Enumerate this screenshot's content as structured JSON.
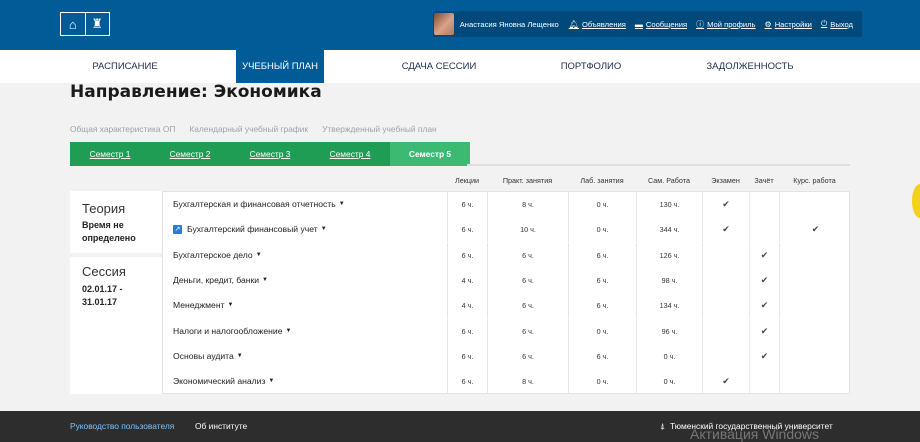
{
  "header": {
    "logo_icons": [
      "university-building-icon",
      "campus-tower-icon"
    ],
    "user_name": "Анастасия Яновна Лещенко",
    "links": [
      {
        "label": "Объявления",
        "icon": "bell-icon"
      },
      {
        "label": "Сообщения",
        "icon": "message-icon"
      },
      {
        "label": "Мой профиль",
        "icon": "info-icon"
      },
      {
        "label": "Настройки",
        "icon": "gear-icon"
      },
      {
        "label": "Выход",
        "icon": "power-icon"
      }
    ]
  },
  "nav": [
    "Расписание",
    "Учебный план",
    "Сдача сессии",
    "Портфолио",
    "Задолженность"
  ],
  "nav_active": "Учебный план",
  "page": {
    "title": "Направление: Экономика",
    "sublinks": [
      "Общая характеристика ОП",
      "Календарный учебный график",
      "Утвержденный учебный план"
    ]
  },
  "semesters": [
    "Семестр 1",
    "Семестр 2",
    "Семестр 3",
    "Семестр 4",
    "Семестр 5"
  ],
  "active_semester": "Семестр 5",
  "left_panel": {
    "theory_heading": "Теория",
    "theory_text": "Время не определено",
    "session_heading": "Сессия",
    "session_dates": "02.01.17 - 31.01.17"
  },
  "table": {
    "columns": [
      "Лекции",
      "Практ. занятия",
      "Лаб. занятия",
      "Сам. Работа",
      "Экзамен",
      "Зачёт",
      "Курс. работа"
    ],
    "rows": [
      {
        "name": "Бухгалтерская и финансовая отчетность",
        "ext": false,
        "lec": "6 ч.",
        "prac": "8 ч.",
        "lab": "0 ч.",
        "self": "130 ч.",
        "exam": true,
        "credit": false,
        "course": false
      },
      {
        "name": "Бухгалтерский финансовый учет",
        "ext": true,
        "lec": "6 ч.",
        "prac": "10 ч.",
        "lab": "0 ч.",
        "self": "344 ч.",
        "exam": true,
        "credit": false,
        "course": true
      },
      {
        "name": "Бухгалтерское дело",
        "ext": false,
        "lec": "6 ч.",
        "prac": "6 ч.",
        "lab": "6 ч.",
        "self": "126 ч.",
        "exam": false,
        "credit": true,
        "course": false
      },
      {
        "name": "Деньги, кредит, банки",
        "ext": false,
        "lec": "4 ч.",
        "prac": "6 ч.",
        "lab": "6 ч.",
        "self": "98 ч.",
        "exam": false,
        "credit": true,
        "course": false
      },
      {
        "name": "Менеджмент",
        "ext": false,
        "lec": "4 ч.",
        "prac": "6 ч.",
        "lab": "6 ч.",
        "self": "134 ч.",
        "exam": false,
        "credit": true,
        "course": false
      },
      {
        "name": "Налоги и налогообложение",
        "ext": false,
        "lec": "6 ч.",
        "prac": "6 ч.",
        "lab": "0 ч.",
        "self": "96 ч.",
        "exam": false,
        "credit": true,
        "course": false
      },
      {
        "name": "Основы аудита",
        "ext": false,
        "lec": "6 ч.",
        "prac": "6 ч.",
        "lab": "6 ч.",
        "self": "0 ч.",
        "exam": false,
        "credit": true,
        "course": false
      },
      {
        "name": "Экономический анализ",
        "ext": false,
        "lec": "6 ч.",
        "prac": "8 ч.",
        "lab": "0 ч.",
        "self": "0 ч.",
        "exam": true,
        "credit": false,
        "course": false
      }
    ]
  },
  "footer": {
    "guide": "Руководство пользователя",
    "about": "Об институте",
    "university": "Тюменский государственный университет",
    "watermark": "Активация Windows"
  }
}
